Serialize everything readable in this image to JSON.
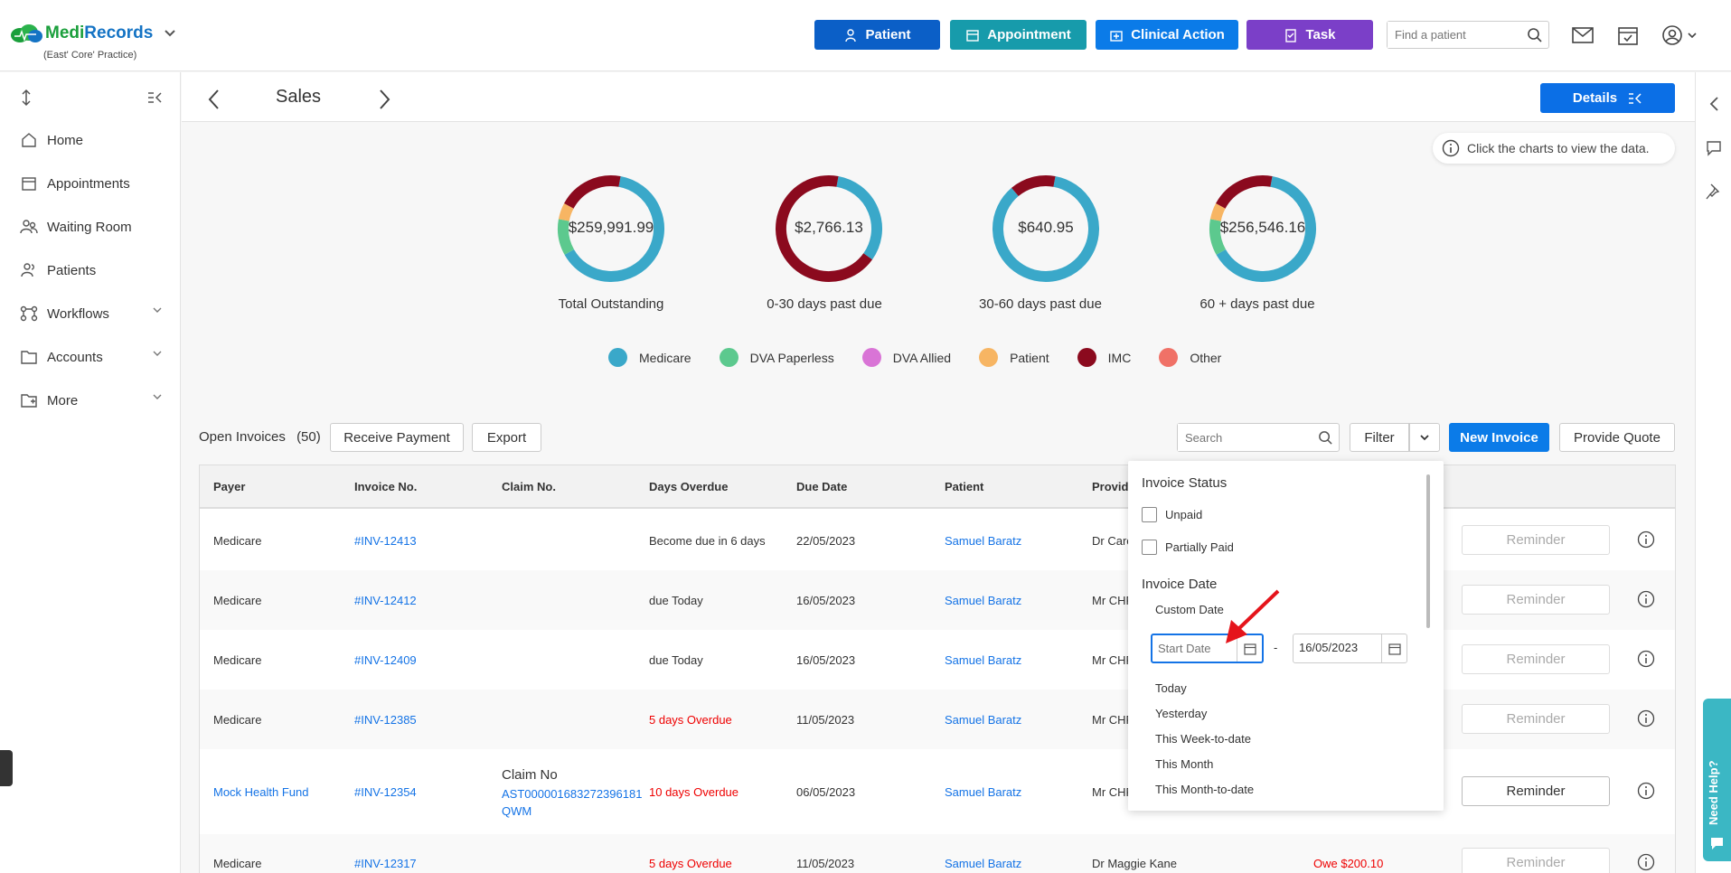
{
  "app": {
    "brand_part1": "Medi",
    "brand_part2": "Records",
    "practice": "(East' Core' Practice)"
  },
  "topbar": {
    "patient_btn": "Patient",
    "appointment_btn": "Appointment",
    "clinical_btn": "Clinical Action",
    "task_btn": "Task",
    "find_placeholder": "Find a patient"
  },
  "sidebar": {
    "items": [
      {
        "label": "Home",
        "icon": "home-icon"
      },
      {
        "label": "Appointments",
        "icon": "calendar-icon"
      },
      {
        "label": "Waiting Room",
        "icon": "people-icon"
      },
      {
        "label": "Patients",
        "icon": "patients-icon"
      },
      {
        "label": "Workflows",
        "icon": "workflow-icon"
      },
      {
        "label": "Accounts",
        "icon": "folder-icon"
      },
      {
        "label": "More",
        "icon": "more-icon"
      }
    ]
  },
  "page": {
    "title": "Sales",
    "details_btn": "Details",
    "hint": "Click the charts to view the data."
  },
  "donuts": [
    {
      "value": "$259,991.99",
      "label": "Total Outstanding"
    },
    {
      "value": "$2,766.13",
      "label": "0-30 days past due"
    },
    {
      "value": "$640.95",
      "label": "30-60 days past due"
    },
    {
      "value": "$256,546.16",
      "label": "60 + days past due"
    }
  ],
  "legend": [
    {
      "label": "Medicare",
      "color": "#3aa8c9"
    },
    {
      "label": "DVA Paperless",
      "color": "#5cc98e"
    },
    {
      "label": "DVA Allied",
      "color": "#d974d6"
    },
    {
      "label": "Patient",
      "color": "#f7b563"
    },
    {
      "label": "IMC",
      "color": "#8b0a1e"
    },
    {
      "label": "Other",
      "color": "#f07167"
    }
  ],
  "chart_data": [
    {
      "type": "pie",
      "title": "Total Outstanding",
      "center_label": "$259,991.99",
      "labels": [
        "Medicare",
        "DVA Paperless",
        "Patient",
        "IMC"
      ],
      "values": [
        64,
        11,
        5,
        20
      ]
    },
    {
      "type": "pie",
      "title": "0-30 days past due",
      "center_label": "$2,766.13",
      "labels": [
        "Medicare",
        "IMC"
      ],
      "values": [
        32,
        68
      ]
    },
    {
      "type": "pie",
      "title": "30-60 days past due",
      "center_label": "$640.95",
      "labels": [
        "Medicare",
        "IMC"
      ],
      "values": [
        86,
        14
      ]
    },
    {
      "type": "pie",
      "title": "60 + days past due",
      "center_label": "$256,546.16",
      "labels": [
        "Medicare",
        "DVA Paperless",
        "Patient",
        "IMC"
      ],
      "values": [
        64,
        11,
        5,
        20
      ]
    }
  ],
  "toolbar": {
    "open_invoices": "Open Invoices",
    "count": "(50)",
    "receive_payment": "Receive Payment",
    "export": "Export",
    "search_placeholder": "Search",
    "filter": "Filter",
    "new_invoice": "New Invoice",
    "provide_quote": "Provide Quote"
  },
  "table": {
    "headers": [
      "Payer",
      "Invoice No.",
      "Claim No.",
      "Days Overdue",
      "Due Date",
      "Patient",
      "Provider"
    ],
    "rows": [
      {
        "payer": "Medicare",
        "invoice": "#INV-12413",
        "claim_label": "",
        "claim": "",
        "overdue": "Become due in 6 days",
        "due": "22/05/2023",
        "patient": "Samuel Baratz",
        "provider": "Dr Care",
        "owe": "",
        "reminder": "Reminder"
      },
      {
        "payer": "Medicare",
        "invoice": "#INV-12412",
        "claim_label": "",
        "claim": "",
        "overdue": "due Today",
        "due": "16/05/2023",
        "patient": "Samuel Baratz",
        "provider": "Mr CHF",
        "owe": "",
        "reminder": "Reminder"
      },
      {
        "payer": "Medicare",
        "invoice": "#INV-12409",
        "claim_label": "",
        "claim": "",
        "overdue": "due Today",
        "due": "16/05/2023",
        "patient": "Samuel Baratz",
        "provider": "Mr CHF",
        "owe": "",
        "reminder": "Reminder"
      },
      {
        "payer": "Medicare",
        "invoice": "#INV-12385",
        "claim_label": "",
        "claim": "",
        "overdue": "5 days Overdue",
        "due": "11/05/2023",
        "patient": "Samuel Baratz",
        "provider": "Mr CHF",
        "owe": "",
        "reminder": "Reminder"
      },
      {
        "payer": "Mock Health Fund",
        "invoice": "#INV-12354",
        "claim_label": "Claim No",
        "claim_line1": "AST000001683272396181",
        "claim_line2": "QWM",
        "overdue": "10 days Overdue",
        "due": "06/05/2023",
        "patient": "Samuel Baratz",
        "provider": "Mr CHF",
        "owe": "",
        "reminder": "Reminder"
      },
      {
        "payer": "Medicare",
        "invoice": "#INV-12317",
        "claim_label": "",
        "claim": "",
        "overdue": "5 days Overdue",
        "due": "11/05/2023",
        "patient": "Samuel Baratz",
        "provider": "Dr Maggie Kane",
        "owe": "Owe $200.10",
        "reminder": "Reminder"
      }
    ]
  },
  "filter_panel": {
    "status_title": "Invoice Status",
    "unpaid": "Unpaid",
    "partially_paid": "Partially Paid",
    "date_title": "Invoice Date",
    "custom_date": "Custom Date",
    "start_placeholder": "Start Date",
    "end_value": "16/05/2023",
    "dash": "-",
    "presets": [
      "Today",
      "Yesterday",
      "This Week-to-date",
      "This Month",
      "This Month-to-date"
    ]
  },
  "help": {
    "label": "Need Help?"
  }
}
